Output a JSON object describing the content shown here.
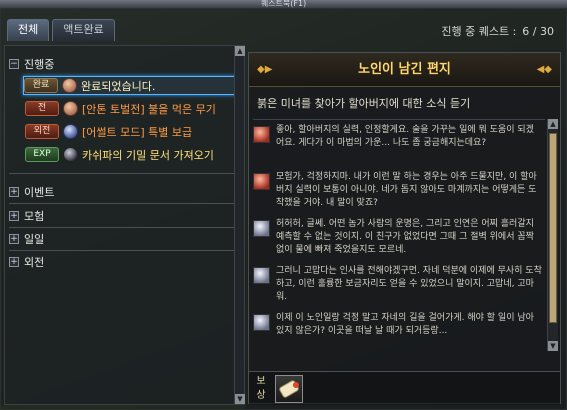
{
  "window": {
    "title": "퀘스트북(F1)"
  },
  "tabs": [
    {
      "label": "전체"
    },
    {
      "label": "액트완료"
    }
  ],
  "progress": {
    "label": "진행 중 퀘스트 :",
    "value": "6 / 30"
  },
  "groups": {
    "in_progress": {
      "label": "진행중",
      "toggle": "−"
    },
    "event": {
      "label": "이벤트",
      "toggle": "+"
    },
    "adventure": {
      "label": "모험",
      "toggle": "+"
    },
    "daily": {
      "label": "일일",
      "toggle": "+"
    },
    "side": {
      "label": "외전",
      "toggle": "+"
    }
  },
  "quests": [
    {
      "badge": "완료",
      "title": "완료되었습니다."
    },
    {
      "badge": "전",
      "title": "[안톤 토벌전] 불을 먹은 무기"
    },
    {
      "badge": "외전",
      "title": "[어썰트 모드] 특별 보급"
    },
    {
      "badge": "EXP",
      "title": "카쉬파의 기밀 문서 가져오기"
    }
  ],
  "detail": {
    "title": "노인이 남긴 편지",
    "summary": "붉은 미녀를 찾아가 할아버지에 대한 소식 듣기",
    "dialogs": [
      {
        "speaker": "red",
        "text": "좋아, 할아버지의 실력, 인정할게요. 술을 가꾸는 일에 뭐 도움이 되겠어요. 게다가 이 마법의 가운... 나도 좀 궁금해지는데요?"
      },
      {
        "speaker": "red",
        "text": "모험가, 걱정하지마. 내가 이런 말 하는 경우는 아주 드물지만, 이 할아버지 실력이 보통이 아니야. 네가 돕지 않아도 마계까지는 어떻게든 도착했을 거야. 내 말이 맞죠?"
      },
      {
        "speaker": "silver",
        "text": "허허허, 글쎄. 어떤 놈가 사람의 운명은, 그리고 인연은 어찌 흘러갈지 예측할 수 없는 것이지. 이 친구가 없었다면 그때 그 절벽 위에서 꼼짝없이 물에 빠져 죽었을지도 모르네."
      },
      {
        "speaker": "silver",
        "text": "그러니 고맙다는 인사를 전해야겠구먼. 자네 덕분에 이제에 무사히 도착하고, 이런 훌륭한 보금자리도 얻을 수 있었으니 말이지. 고맙네, 고마워."
      },
      {
        "speaker": "silver",
        "text": "이제 이 노인일랑 걱정 말고 자네의 길을 걸어가게. 해야 할 일이 남아있지 않은가? 이곳을 떠날 날 때가 되거등랑..."
      }
    ],
    "reward_label": "보상"
  }
}
